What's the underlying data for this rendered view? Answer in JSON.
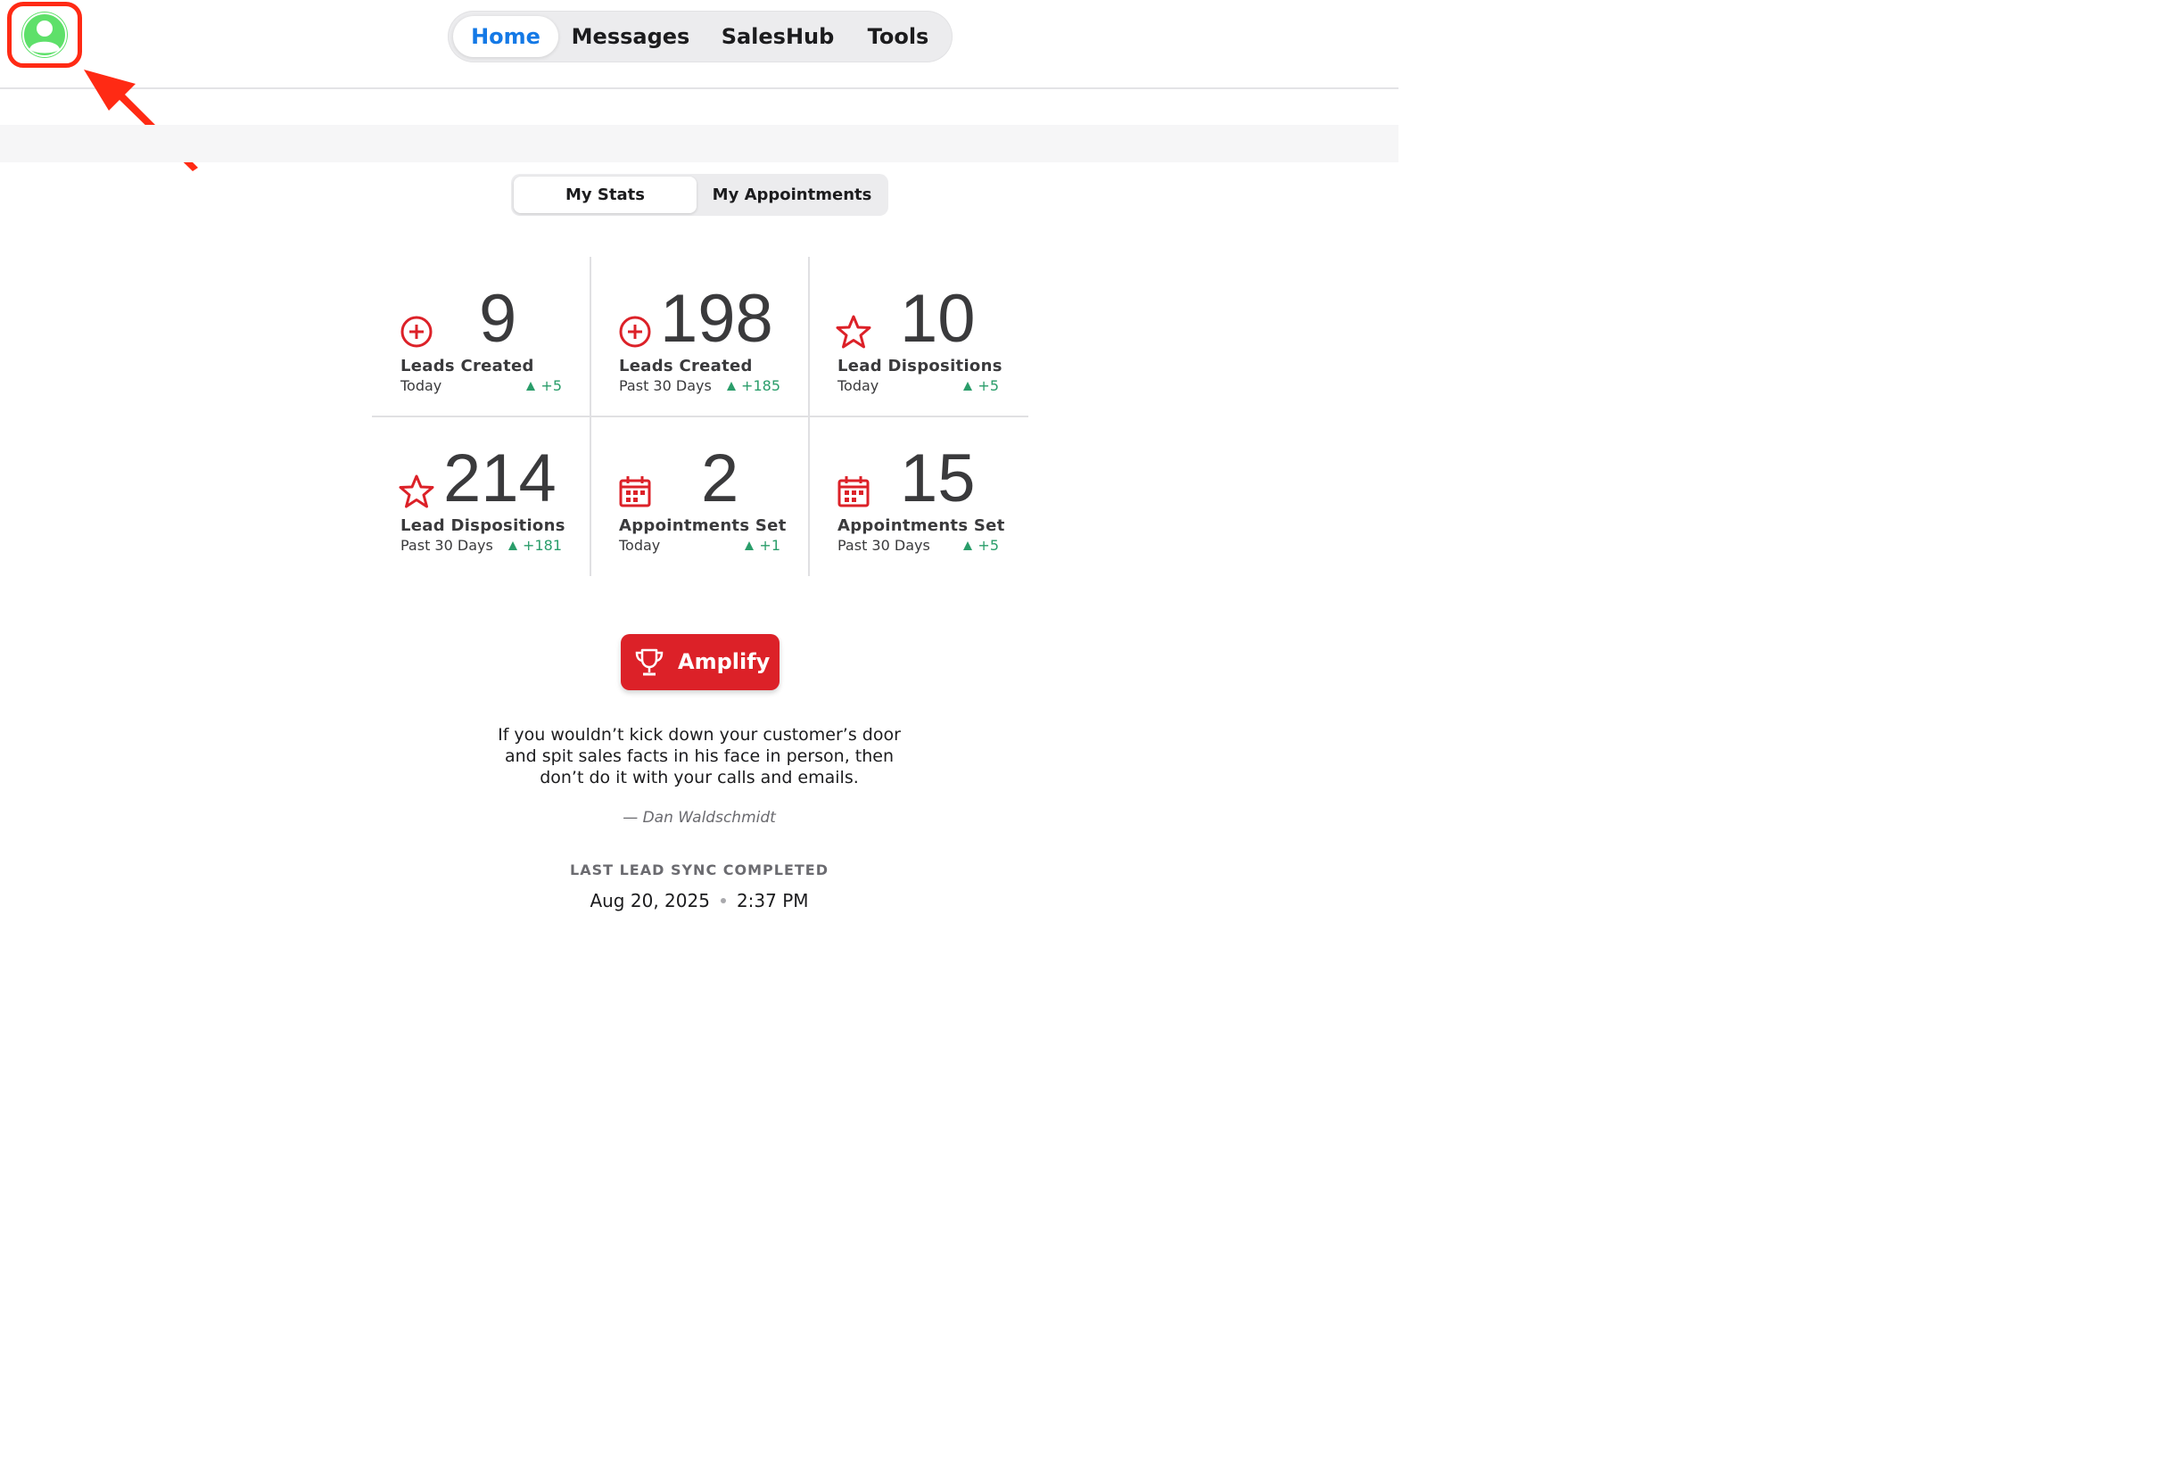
{
  "nav": {
    "items": [
      {
        "label": "Home",
        "active": true
      },
      {
        "label": "Messages",
        "active": false
      },
      {
        "label": "SalesHub",
        "active": false
      },
      {
        "label": "Tools",
        "active": false
      }
    ]
  },
  "segment": {
    "items": [
      {
        "label": "My Stats",
        "active": true
      },
      {
        "label": "My Appointments",
        "active": false
      }
    ]
  },
  "stats": [
    {
      "icon": "plus-circle-icon",
      "value": "9",
      "label": "Leads Created",
      "period": "Today",
      "delta": "+5"
    },
    {
      "icon": "plus-circle-icon",
      "value": "198",
      "label": "Leads Created",
      "period": "Past 30 Days",
      "delta": "+185"
    },
    {
      "icon": "star-icon",
      "value": "10",
      "label": "Lead Dispositions",
      "period": "Today",
      "delta": "+5"
    },
    {
      "icon": "star-icon",
      "value": "214",
      "label": "Lead Dispositions",
      "period": "Past 30 Days",
      "delta": "+181"
    },
    {
      "icon": "calendar-icon",
      "value": "2",
      "label": "Appointments Set",
      "period": "Today",
      "delta": "+1"
    },
    {
      "icon": "calendar-icon",
      "value": "15",
      "label": "Appointments Set",
      "period": "Past 30 Days",
      "delta": "+5"
    }
  ],
  "amplify": {
    "label": "Amplify",
    "icon": "trophy-icon"
  },
  "quote": {
    "lines": [
      "If you wouldn’t kick down your customer’s door",
      "and spit sales facts in his face in person, then",
      "don’t do it with your calls and emails."
    ],
    "author": "— Dan Waldschmidt"
  },
  "sync": {
    "title": "LAST LEAD SYNC COMPLETED",
    "date": "Aug 20, 2025",
    "time": "2:37 PM"
  },
  "colors": {
    "accent": "#1479e6",
    "brand_red": "#dc2128",
    "delta_green": "#2a9d6a",
    "annotation": "#ff2a14"
  }
}
